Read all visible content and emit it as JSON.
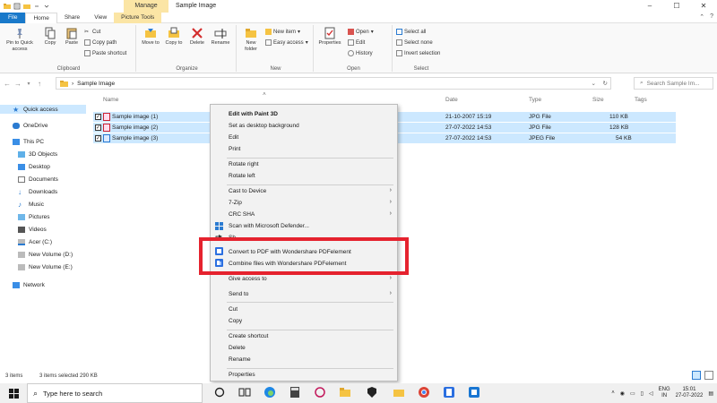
{
  "window": {
    "title": "Sample Image",
    "manage_tab": "Manage",
    "controls": [
      "–",
      "☐",
      "✕"
    ]
  },
  "ribbon_tabs": [
    "File",
    "Home",
    "Share",
    "View",
    "Picture Tools"
  ],
  "ribbon": {
    "clipboard": {
      "pin_label": "Pin to Quick access",
      "copy_label": "Copy",
      "paste_label": "Paste",
      "cut_label": "Cut",
      "copy_path_label": "Copy path",
      "paste_shortcut_label": "Paste shortcut",
      "group_label": "Clipboard"
    },
    "organize": {
      "move_to_label": "Move to",
      "copy_to_label": "Copy to",
      "delete_label": "Delete",
      "rename_label": "Rename",
      "group_label": "Organize"
    },
    "new": {
      "new_folder_label": "New folder",
      "new_item_label": "New item",
      "easy_access_label": "Easy access",
      "group_label": "New"
    },
    "open": {
      "properties_label": "Properties",
      "open_label": "Open",
      "edit_label": "Edit",
      "history_label": "History",
      "group_label": "Open"
    },
    "select": {
      "select_all_label": "Select all",
      "select_none_label": "Select none",
      "invert_label": "Invert selection",
      "group_label": "Select"
    }
  },
  "address": {
    "path": "Sample Image",
    "search_placeholder": "Search Sample Im..."
  },
  "nav": {
    "items": [
      "Quick access",
      "OneDrive",
      "This PC",
      "3D Objects",
      "Desktop",
      "Documents",
      "Downloads",
      "Music",
      "Pictures",
      "Videos",
      "Acer (C:)",
      "New Volume (D:)",
      "New Volume (E:)",
      "Network"
    ]
  },
  "columns": [
    "Name",
    "Date",
    "Type",
    "Size",
    "Tags"
  ],
  "files": [
    {
      "name": "Sample image (1)",
      "date": "21-10-2007 15:19",
      "type": "JPG File",
      "size": "110 KB"
    },
    {
      "name": "Sample image (2)",
      "date": "27-07-2022 14:53",
      "type": "JPG File",
      "size": "128 KB"
    },
    {
      "name": "Sample image (3)",
      "date": "27-07-2022 14:53",
      "type": "JPEG File",
      "size": "54 KB"
    }
  ],
  "status": {
    "count": "3 items",
    "selected": "3 items selected  290 KB"
  },
  "context_menu": {
    "edit_paint3d": "Edit with Paint 3D",
    "set_background": "Set as desktop background",
    "edit": "Edit",
    "print": "Print",
    "rotate_right": "Rotate right",
    "rotate_left": "Rotate left",
    "cast": "Cast to Device",
    "zip": "7-Zip",
    "crc": "CRC SHA",
    "scan": "Scan with Microsoft Defender...",
    "share_partial": "Sh",
    "convert_pdf": "Convert to PDF with Wondershare PDFelement",
    "combine_files": "Combine files with Wondershare PDFelement",
    "give_access": "Give access to",
    "send_to": "Send to",
    "cut": "Cut",
    "copy": "Copy",
    "create_shortcut": "Create shortcut",
    "delete": "Delete",
    "rename": "Rename",
    "properties": "Properties"
  },
  "taskbar": {
    "search_placeholder": "Type here to search",
    "lang_line1": "ENG",
    "lang_line2": "IN",
    "time": "15:01",
    "date": "27-07-2022"
  },
  "colors": {
    "accent": "#1979ca",
    "selection": "#cce8ff",
    "highlight_box": "#e5222e",
    "picture_tools": "#fbe5a5"
  }
}
